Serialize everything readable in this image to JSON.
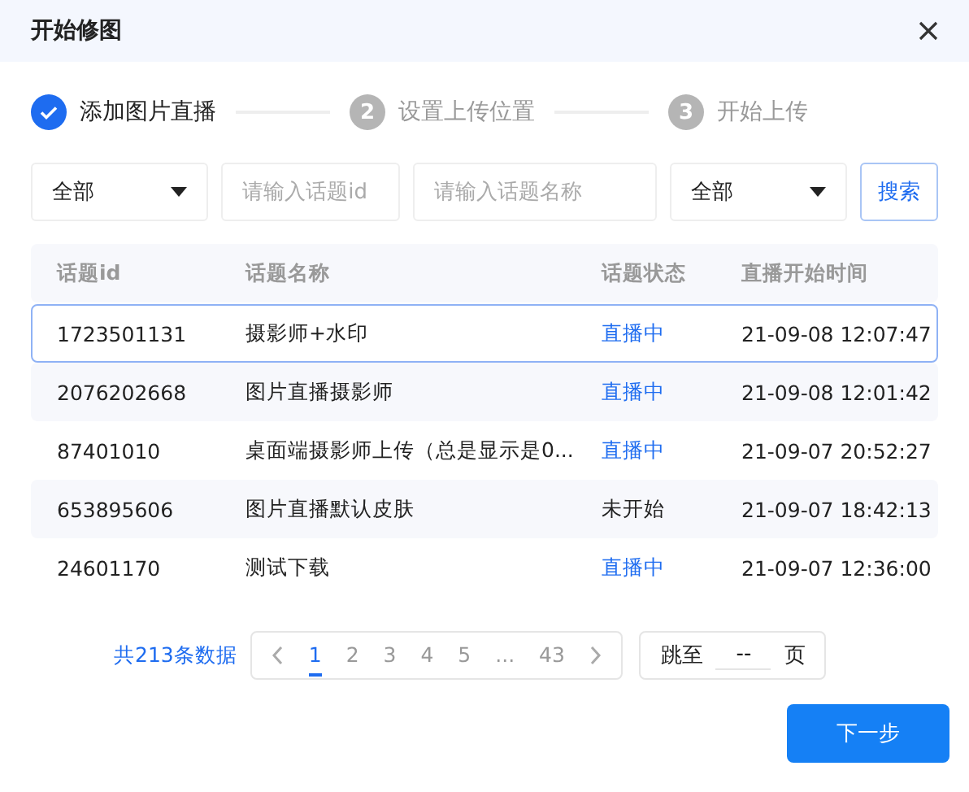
{
  "window": {
    "title": "开始修图"
  },
  "steps": [
    {
      "label": "添加图片直播",
      "completed": true
    },
    {
      "number": "2",
      "label": "设置上传位置",
      "completed": false
    },
    {
      "number": "3",
      "label": "开始上传",
      "completed": false
    }
  ],
  "filters": {
    "type_select": {
      "value": "全部"
    },
    "id_field": {
      "placeholder": "请输入话题id"
    },
    "name_field": {
      "placeholder": "请输入话题名称"
    },
    "status_select": {
      "value": "全部"
    },
    "search_button": "搜索"
  },
  "table": {
    "columns": [
      "话题id",
      "话题名称",
      "话题状态",
      "直播开始时间"
    ],
    "rows": [
      {
        "id": "1723501131",
        "name": "摄影师+水印",
        "status": "直播中",
        "live": true,
        "start": "21-09-08 12:07:47",
        "selected": true
      },
      {
        "id": "2076202668",
        "name": "图片直播摄影师",
        "status": "直播中",
        "live": true,
        "start": "21-09-08 12:01:42",
        "selected": false
      },
      {
        "id": "87401010",
        "name": "桌面端摄影师上传（总是显示是0...",
        "status": "直播中",
        "live": true,
        "start": "21-09-07 20:52:27",
        "selected": false
      },
      {
        "id": "653895606",
        "name": "图片直播默认皮肤",
        "status": "未开始",
        "live": false,
        "start": "21-09-07 18:42:13",
        "selected": false
      },
      {
        "id": "24601170",
        "name": "测试下载",
        "status": "直播中",
        "live": true,
        "start": "21-09-07 12:36:00",
        "selected": false
      }
    ]
  },
  "pagination": {
    "total": "共213条数据",
    "pages": [
      {
        "label": "1",
        "selected": true
      },
      {
        "label": "2",
        "selected": false
      },
      {
        "label": "3",
        "selected": false
      },
      {
        "label": "4",
        "selected": false
      },
      {
        "label": "5",
        "selected": false
      },
      {
        "label": "...",
        "selected": false
      },
      {
        "label": "43",
        "selected": false
      }
    ],
    "jump_label": "跳至",
    "jump_value": "--",
    "jump_suffix": "页"
  },
  "next_button": "下一步"
}
